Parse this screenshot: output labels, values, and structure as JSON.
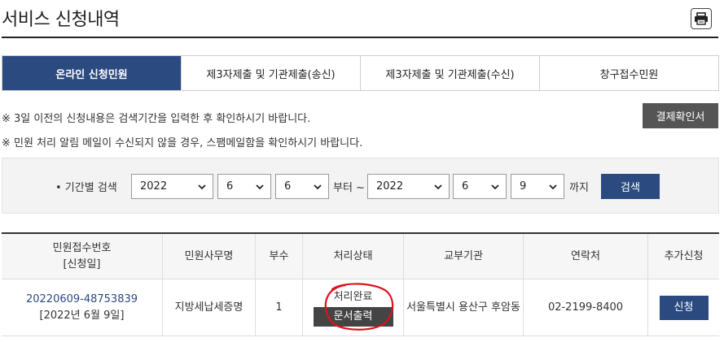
{
  "page": {
    "title": "서비스 신청내역"
  },
  "tabs": [
    {
      "label": "온라인 신청민원",
      "active": true
    },
    {
      "label": "제3자제출 및 기관제출(송신)",
      "active": false
    },
    {
      "label": "제3자제출 및 기관제출(수신)",
      "active": false
    },
    {
      "label": "창구접수민원",
      "active": false
    }
  ],
  "notices": {
    "line1": "※ 3일 이전의 신청내용은 검색기간을 입력한 후 확인하시기 바랍니다.",
    "line2": "※ 민원 처리 알림 메일이 수신되지 않을 경우, 스팸메일함을 확인하시기 바랍니다."
  },
  "buttons": {
    "payment_confirm": "결제확인서",
    "search": "검색",
    "print_icon": "printer-icon"
  },
  "search": {
    "label": "• 기간별 검색",
    "from": {
      "year": "2022",
      "month": "6",
      "day": "6"
    },
    "from_suffix": "부터 ~",
    "to": {
      "year": "2022",
      "month": "6",
      "day": "9"
    },
    "to_suffix": "까지"
  },
  "table": {
    "headers": {
      "receipt_no": "민원접수번호",
      "apply_date": "[신청일]",
      "doc_name": "민원사무명",
      "copies": "부수",
      "status": "처리상태",
      "agency": "교부기관",
      "contact": "연락처",
      "extra": "추가신청"
    },
    "rows": [
      {
        "receipt_no": "20220609-48753839",
        "apply_date": "[2022년 6월 9일]",
        "doc_name": "지방세납세증명",
        "copies": "1",
        "status": "처리완료",
        "print_doc": "문서출력",
        "agency": "서울특별시 용산구 후암동",
        "contact": "02-2199-8400",
        "apply": "신청"
      }
    ]
  },
  "colors": {
    "accent": "#2b4a80",
    "dark_button": "#555555",
    "annotation": "#e0101a"
  }
}
